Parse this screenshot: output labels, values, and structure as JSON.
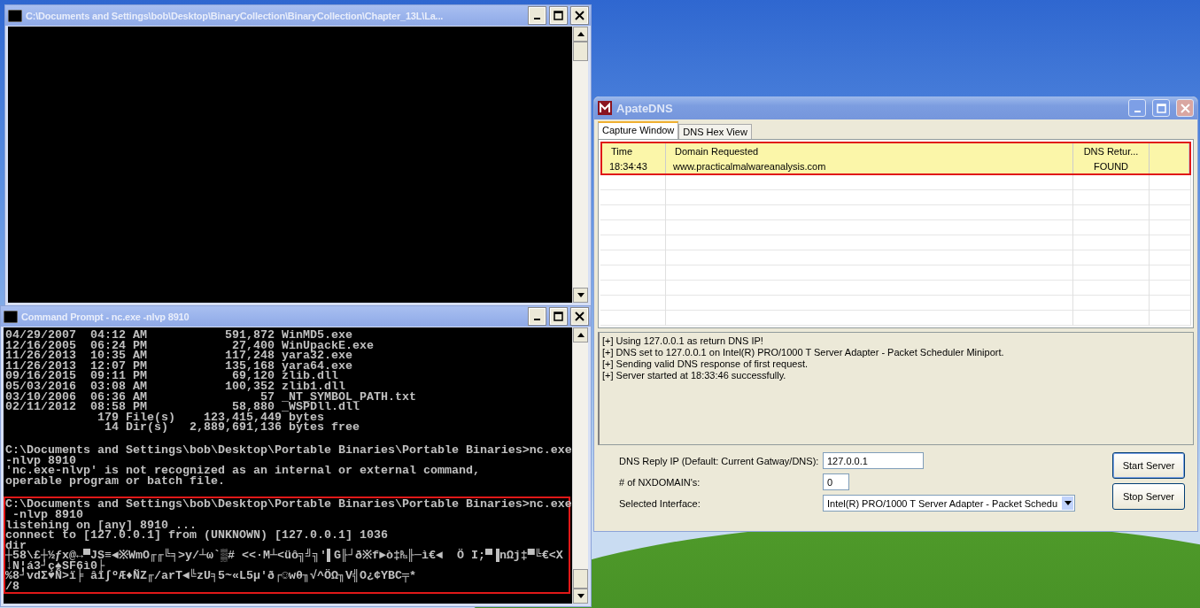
{
  "windows": [
    {
      "kind": "console",
      "title": "C:\\Documents and Settings\\bob\\Desktop\\BinaryCollection\\BinaryCollection\\Chapter_13L\\La..."
    },
    {
      "kind": "console",
      "title": "Command Prompt - nc.exe -nlvp 8910",
      "blocks": [
        {
          "highlighted": false,
          "lines": [
            "04/29/2007  04:12 AM           591,872 WinMD5.exe",
            "12/16/2005  06:24 PM            27,400 WinUpackE.exe",
            "11/26/2013  10:35 AM           117,248 yara32.exe",
            "11/26/2013  12:07 PM           135,168 yara64.exe",
            "09/16/2015  09:11 PM            69,120 zlib.dll",
            "05/03/2016  03:08 AM           100,352 zlib1.dll",
            "03/10/2006  06:36 AM                57 _NT_SYMBOL_PATH.txt",
            "02/11/2012  08:58 PM            58,880 _WSPDll.dll",
            "             179 File(s)    123,415,449 bytes",
            "              14 Dir(s)   2,889,691,136 bytes free"
          ]
        },
        {
          "highlighted": false,
          "lines": [
            "C:\\Documents and Settings\\bob\\Desktop\\Portable Binaries\\Portable Binaries>nc.exe",
            "-nlvp 8910",
            "'nc.exe-nlvp' is not recognized as an internal or external command,",
            "operable program or batch file."
          ]
        },
        {
          "highlighted": true,
          "lines": [
            "C:\\Documents and Settings\\bob\\Desktop\\Portable Binaries\\Portable Binaries>nc.exe",
            " -nlvp 8910",
            "listening on [any] 8910 ...",
            "connect to [127.0.0.1] from (UNKNOWN) [127.0.0.1] 1036",
            "dir",
            "┼58\\£┼½ƒx@↔▀JS≡◄※WmO╓╓╚╕>y/┴ω`▒# <<·M┴<üô╗╝╗'▌G╟┘ð※f►ò‡₧╟─ì€◄  Ö I;▀▐nΩj‡▀╚€<X",
            "↓N¦á3┘ç♠SF6ì0├",
            "%8┘vdΣ♥Ñ>ï╞ âï∫ºÆ♦ÑZ╓/arT◄╚zU╕5~«L5µ'ð┌☺wθ╖√^ÖΩ╖V╣O¿¢YBC╤*",
            "/8"
          ]
        }
      ]
    },
    {
      "kind": "apatedns",
      "title": "ApateDNS",
      "tabs": [
        {
          "label": "Capture Window",
          "selected": true
        },
        {
          "label": "DNS Hex View",
          "selected": false
        }
      ],
      "table": {
        "highlighted": true,
        "columns": [
          "Time",
          "Domain Requested",
          "DNS Retur..."
        ],
        "rows": [
          {
            "cells": [
              "18:34:43",
              "www.practicalmalwareanalysis.com",
              "FOUND"
            ]
          }
        ]
      },
      "log": [
        "[+] Using 127.0.0.1 as return DNS IP!",
        "[+] DNS set to 127.0.0.1 on Intel(R) PRO/1000 T Server Adapter - Packet Scheduler Miniport.",
        "[+] Sending valid DNS response of first request.",
        "[+] Server started at 18:33:46 successfully."
      ],
      "fields": [
        {
          "kind": "text",
          "label": "DNS Reply IP (Default: Current Gatway/DNS):",
          "value": "127.0.0.1"
        },
        {
          "kind": "number",
          "label": "# of NXDOMAIN's:",
          "value": "0"
        },
        {
          "kind": "dropdown",
          "label": "Selected Interface:",
          "value": "Intel(R) PRO/1000 T Server Adapter - Packet Schedu"
        }
      ],
      "buttons": [
        "Start Server",
        "Stop Server"
      ]
    }
  ]
}
